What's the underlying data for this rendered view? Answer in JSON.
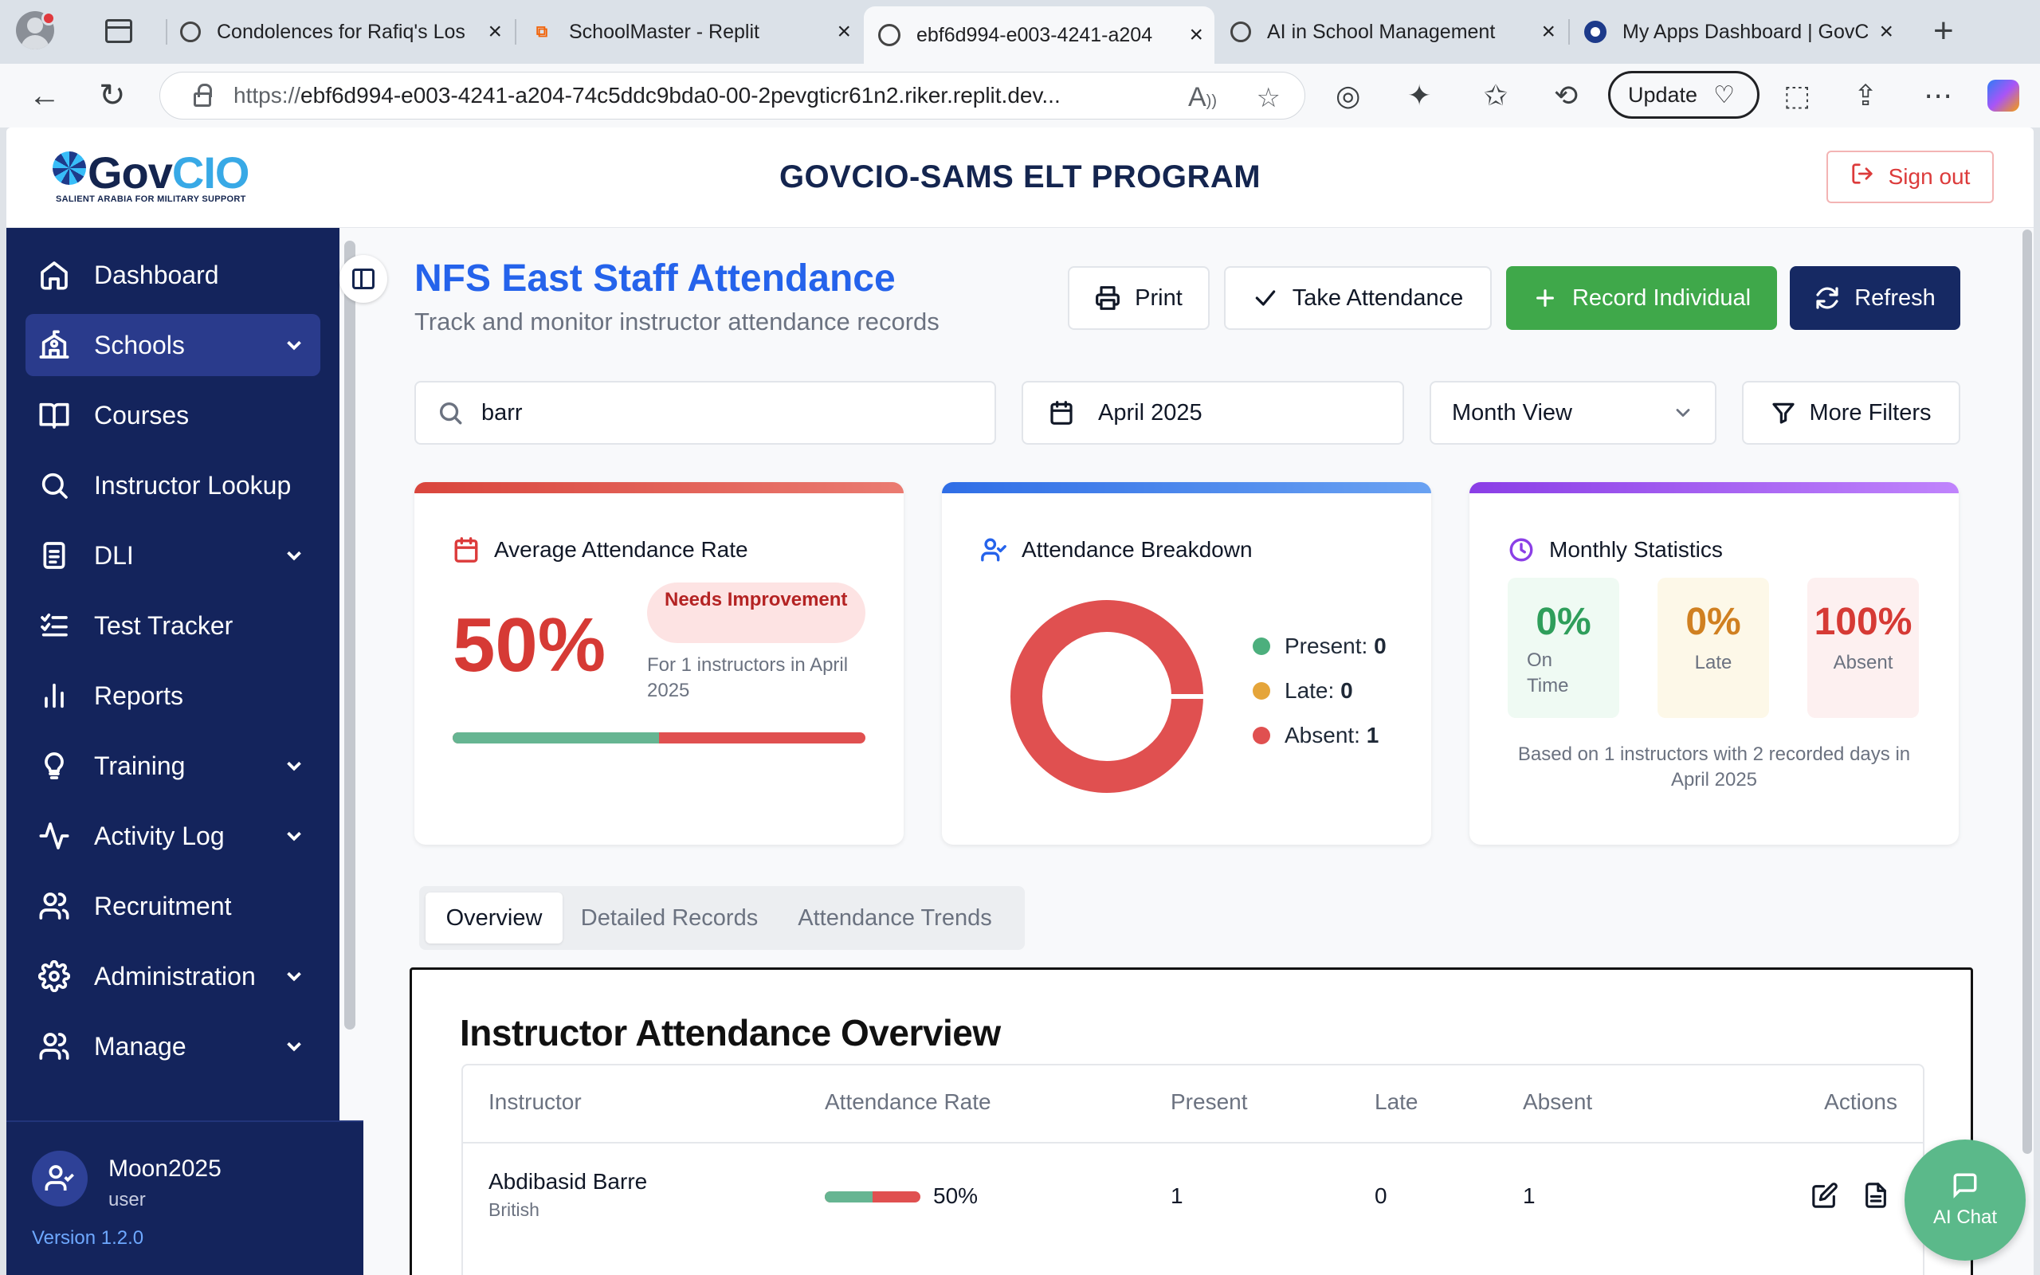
{
  "browser": {
    "tabs": [
      {
        "title": "Condolences for Rafiq's Los",
        "icon": "chatgpt-icon"
      },
      {
        "title": "SchoolMaster - Replit",
        "icon": "replit-icon"
      },
      {
        "title": "ebf6d994-e003-4241-a204",
        "icon": "globe-icon"
      },
      {
        "title": "AI in School Management",
        "icon": "chatgpt-icon"
      },
      {
        "title": "My Apps Dashboard | GovCI",
        "icon": "okta-icon"
      }
    ],
    "url_prefix": "https://",
    "url_host": "ebf6d994-e003-4241-a204-74c5ddc9bda0-00-2pevgticr61n2.riker.replit.dev...",
    "update_label": "Update"
  },
  "header": {
    "logo_word_a": "Gov",
    "logo_word_b": "CIO",
    "logo_tagline": "SALIENT ARABIA FOR MILITARY SUPPORT",
    "title": "GOVCIO-SAMS ELT PROGRAM",
    "signout_label": "Sign out"
  },
  "sidebar": {
    "items": [
      {
        "label": "Dashboard",
        "icon": "home-icon"
      },
      {
        "label": "Schools",
        "icon": "school-icon"
      },
      {
        "label": "Courses",
        "icon": "book-icon"
      },
      {
        "label": "Instructor Lookup",
        "icon": "search-icon"
      },
      {
        "label": "DLI",
        "icon": "clipboard-icon"
      },
      {
        "label": "Test Tracker",
        "icon": "list-check-icon"
      },
      {
        "label": "Reports",
        "icon": "bar-chart-icon"
      },
      {
        "label": "Training",
        "icon": "lightbulb-icon"
      },
      {
        "label": "Activity Log",
        "icon": "activity-icon"
      },
      {
        "label": "Recruitment",
        "icon": "users-icon"
      },
      {
        "label": "Administration",
        "icon": "gear-icon"
      },
      {
        "label": "Manage",
        "icon": "users-icon"
      }
    ],
    "user_name": "Moon2025",
    "user_role": "user",
    "version": "Version 1.2.0"
  },
  "page": {
    "title": "NFS East Staff Attendance",
    "subtitle": "Track and monitor instructor attendance records",
    "actions": {
      "print": "Print",
      "take": "Take Attendance",
      "record": "Record Individual",
      "refresh": "Refresh"
    },
    "filters": {
      "search_value": "barr",
      "month": "April 2025",
      "view": "Month View",
      "more": "More Filters"
    }
  },
  "cards": {
    "average": {
      "title": "Average Attendance Rate",
      "rate": "50%",
      "rate_value": 50,
      "badge": "Needs Improvement",
      "note": "For 1 instructors in April 2025"
    },
    "breakdown": {
      "title": "Attendance Breakdown",
      "legend": [
        {
          "label": "Present:",
          "value": "0",
          "color": "#4caf7d"
        },
        {
          "label": "Late:",
          "value": "0",
          "color": "#e5a53a"
        },
        {
          "label": "Absent:",
          "value": "1",
          "color": "#e05050"
        }
      ]
    },
    "monthly": {
      "title": "Monthly Statistics",
      "on_time_value": "0%",
      "on_time_label": "On Time",
      "late_value": "0%",
      "late_label": "Late",
      "absent_value": "100%",
      "absent_label": "Absent",
      "note": "Based on 1 instructors with 2 recorded days in April 2025"
    }
  },
  "tabs": [
    "Overview",
    "Detailed Records",
    "Attendance Trends"
  ],
  "overview": {
    "title": "Instructor Attendance Overview",
    "columns": [
      "Instructor",
      "Attendance Rate",
      "Present",
      "Late",
      "Absent",
      "Actions"
    ],
    "rows": [
      {
        "name": "Abdibasid Barre",
        "nationality": "British",
        "rate": "50%",
        "rate_value": 50,
        "present": "1",
        "late": "0",
        "absent": "1"
      }
    ]
  },
  "ai_chat_label": "AI Chat",
  "colors": {
    "navy": "#14245c",
    "accent_blue": "#2563eb",
    "danger": "#d63a35",
    "success": "#3fa84a"
  }
}
